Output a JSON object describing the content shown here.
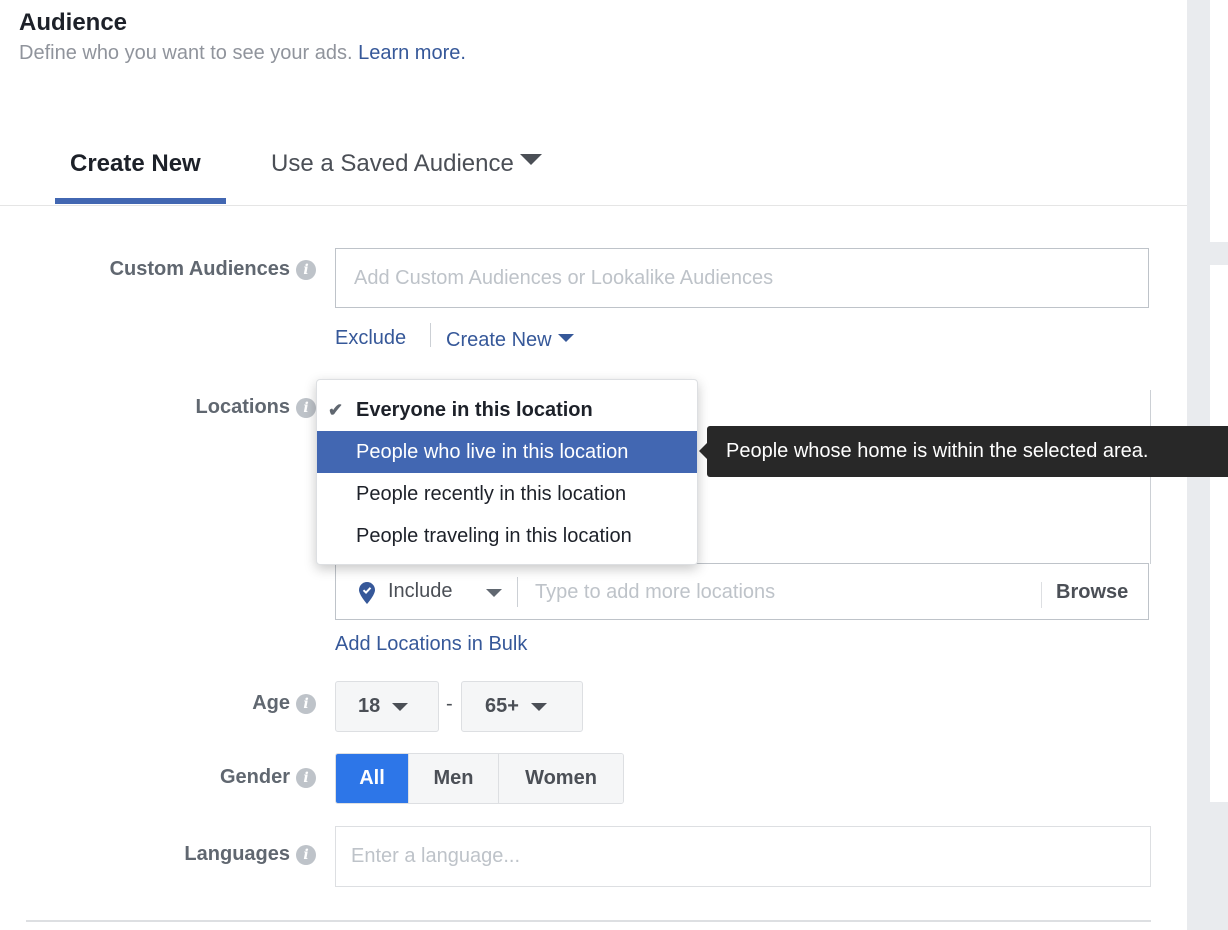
{
  "header": {
    "title": "Audience",
    "subtitle": "Define who you want to see your ads.",
    "learn_more": "Learn more."
  },
  "tabs": [
    {
      "label": "Create New",
      "active": true
    },
    {
      "label": "Use a Saved Audience",
      "active": false
    }
  ],
  "custom_audiences": {
    "label": "Custom Audiences",
    "placeholder": "Add Custom Audiences or Lookalike Audiences",
    "exclude_label": "Exclude",
    "create_new_label": "Create New"
  },
  "locations": {
    "label": "Locations",
    "menu": [
      {
        "label": "Everyone in this location",
        "checked": true
      },
      {
        "label": "People who live in this location",
        "highlighted": true
      },
      {
        "label": "People recently in this location"
      },
      {
        "label": "People traveling in this location"
      }
    ],
    "tooltip": "People whose home is within the selected area.",
    "include_label": "Include",
    "placeholder": "Type to add more locations",
    "browse_label": "Browse",
    "bulk_label": "Add Locations in Bulk"
  },
  "age": {
    "label": "Age",
    "min": "18",
    "separator": "-",
    "max": "65+"
  },
  "gender": {
    "label": "Gender",
    "options": [
      "All",
      "Men",
      "Women"
    ],
    "selected": "All"
  },
  "languages": {
    "label": "Languages",
    "placeholder": "Enter a language..."
  },
  "colors": {
    "accent": "#4267b2",
    "link": "#365899",
    "selected_segment": "#2d76e8",
    "tooltip_bg": "#282828"
  }
}
